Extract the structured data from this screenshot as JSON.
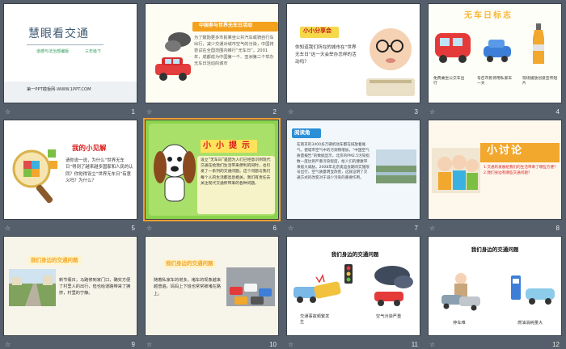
{
  "slides": [
    {
      "num": "1",
      "title": "慧眼看交通",
      "subtitle_left": "道德与法治部编版",
      "subtitle_right": "三年级下",
      "footer": "第一PPT模板网-WWW.1PPT.COM"
    },
    {
      "num": "2",
      "header": "中国参与世界无车日活动",
      "body": "为了鼓励更多市民乘坐公共汽车或骑自行车出行，减少交通对城市空气的污染，中国将尝试在全国范围内推行“无车日”。2001年，成都成为中国第一个、亚洲第二个举办无车日活动的城市"
    },
    {
      "num": "3",
      "header": "小小分享会",
      "body": "你知道我们所在的城市在“世界无车日”这一天会举办怎样的活动吗？"
    },
    {
      "num": "4",
      "header": "无车日标志",
      "captions": [
        "免费乘坐公交车出行",
        "号召市民停用私家车一天",
        "现场播放创意宣传短片"
      ]
    },
    {
      "num": "5",
      "header": "我的小见解",
      "body": "请你说一说，为什么“世界无车日”得到了越来越多国家和人民的认同？你觉得设立“世界无车日”有意义吗？为什么？"
    },
    {
      "num": "6",
      "header": "小小提示",
      "body": "设立“无车日”是因为人们已经意识到现代交通在给我们生活带来便利的同时，也引发了一系列的交通问题。这个问题与我们每个人的生活都息息相关，我们有责任去关注现代交通所带来的各种问题。"
    },
    {
      "num": "7",
      "header": "阅读角",
      "body": "在南京的3400多万辆机动车都在排放着尾气，使城市空气中的污染物增加，“中国空气质量报告”的数据显示，北京的PM2.5污染指数一度达到严重污染程度，给人们的健康带来极大威胁。2008年北京奥运会期间实施限号出行，空气质量明显改善，这就证明了交通方式的改变对于减少污染的重要作用。"
    },
    {
      "num": "8",
      "header": "小讨论",
      "body": "1.交通的发展给我们的生活带来了哪些方便？2.我们身边有哪些交通问题？"
    },
    {
      "num": "9",
      "header": "我们身边的交通问题",
      "body": "新节假日，马路修到家门口，确实方便了村里人的出行，但也给道路带来了拥挤，村里的宁静。"
    },
    {
      "num": "10",
      "header": "我们身边的交通问题",
      "body": "随着私家车的增多，堵车的现象越来越普遍，妈妈上下班也常常被堵在路上。"
    },
    {
      "num": "11",
      "title": "我们身边的交通问题",
      "captions": [
        "交通事故频繁发生",
        "空气污染严重"
      ]
    },
    {
      "num": "12",
      "title": "我们身边的交通问题",
      "captions": [
        "停车难",
        "燃油消耗量大"
      ]
    }
  ]
}
